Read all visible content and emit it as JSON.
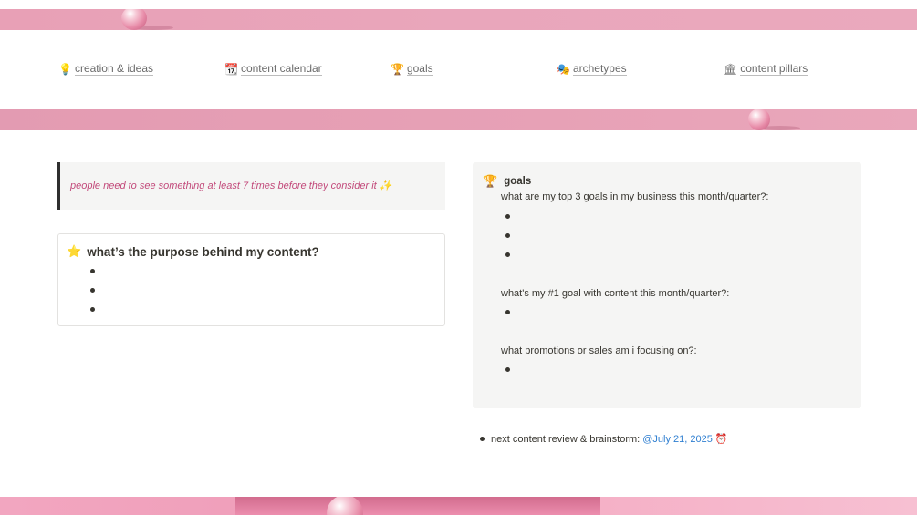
{
  "nav": {
    "items": [
      {
        "icon": "lightbulb-icon",
        "glyph": "💡",
        "label": "creation & ideas"
      },
      {
        "icon": "calendar-icon",
        "glyph": "📆",
        "label": "content calendar"
      },
      {
        "icon": "trophy-icon",
        "glyph": "🏆",
        "label": "goals"
      },
      {
        "icon": "theater-masks-icon",
        "glyph": "🎭",
        "label": "archetypes"
      },
      {
        "icon": "classical-building-icon",
        "glyph": "🏛",
        "label": "content pillars"
      }
    ]
  },
  "quote": {
    "text": "people need to see something at least 7 times before they consider it",
    "sparkle": "✨"
  },
  "purpose": {
    "glyph": "⭐",
    "title": "what’s the purpose behind my content?",
    "bullet_count": 3
  },
  "goals": {
    "glyph": "🏆",
    "title": "goals",
    "questions": [
      "what are my top 3 goals in my business this month/quarter?:",
      "what's my #1 goal with content this month/quarter?:",
      "what promotions or sales am i focusing on?:"
    ]
  },
  "review": {
    "label": "next content review & brainstorm:",
    "date": "@July 21, 2025",
    "alarm_glyph": "⏰"
  },
  "colors": {
    "banner_pink": "#e8a0b6",
    "quote_text": "#c2497a",
    "mention_blue": "#2f7fd1",
    "callout_bg": "#f5f5f4"
  }
}
